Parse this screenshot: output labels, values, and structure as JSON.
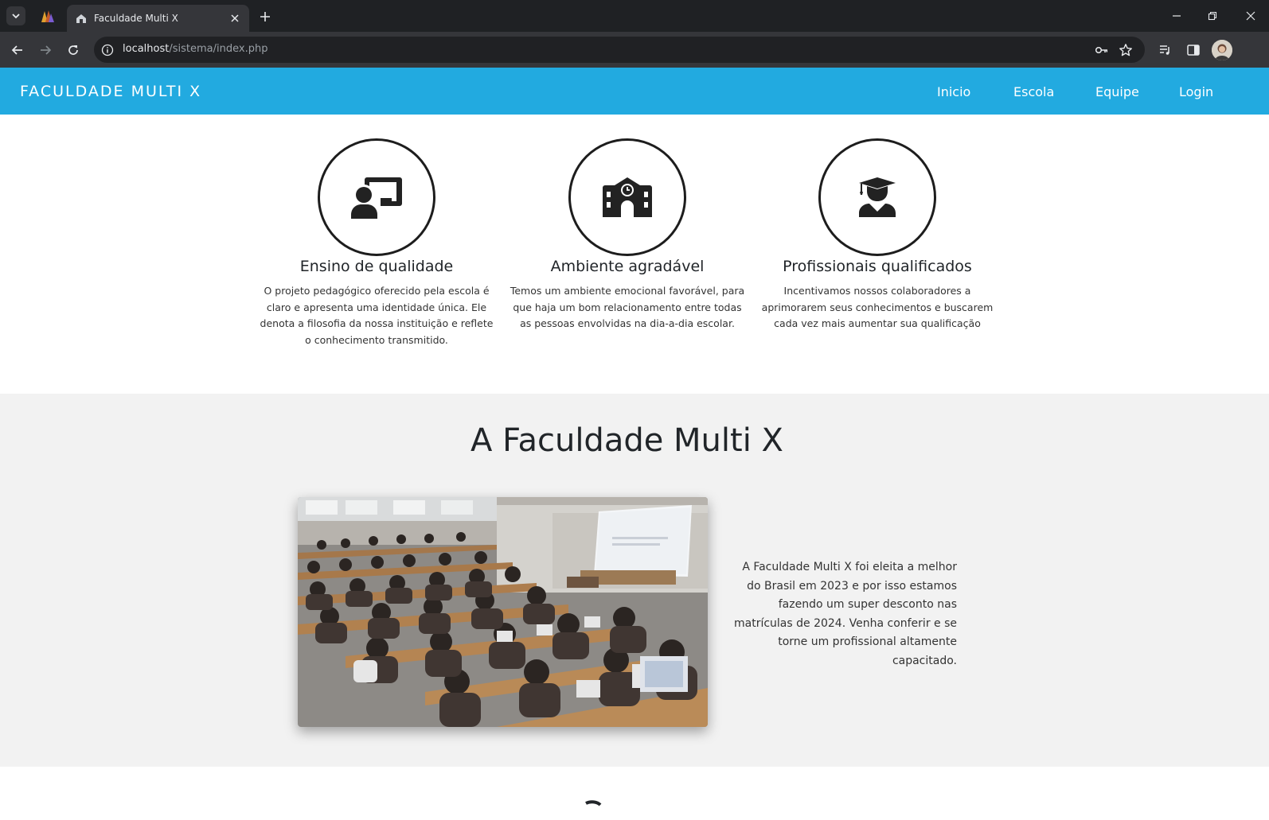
{
  "browser": {
    "tab_title": "Faculdade Multi X",
    "url_host": "localhost",
    "url_path": "/sistema/index.php"
  },
  "navbar": {
    "brand": "FACULDADE MULTI X",
    "links": [
      "Inicio",
      "Escola",
      "Equipe",
      "Login"
    ],
    "color": "#22aae0"
  },
  "features": [
    {
      "icon": "teacher-board-icon",
      "title": "Ensino de qualidade",
      "text": "O projeto pedagógico oferecido pela escola é claro e apresenta uma identidade única. Ele denota a filosofia da nossa instituição e reflete o conhecimento transmitido."
    },
    {
      "icon": "school-building-icon",
      "title": "Ambiente agradável",
      "text": "Temos um ambiente emocional favorável, para que haja um bom relacionamento entre todas as pessoas envolvidas na dia-a-dia escolar."
    },
    {
      "icon": "graduate-icon",
      "title": "Profissionais qualificados",
      "text": "Incentivamos nossos colaboradores a aprimorarem seus conhecimentos e buscarem cada vez mais aumentar sua qualificação"
    }
  ],
  "about": {
    "heading": "A Faculdade Multi X",
    "text": "A Faculdade Multi X foi eleita a melhor do Brasil em 2023 e por isso estamos fazendo um super desconto nas matrículas de 2024. Venha conferir e se torne um profissional altamente capacitado.",
    "background": "#f2f2f2"
  }
}
